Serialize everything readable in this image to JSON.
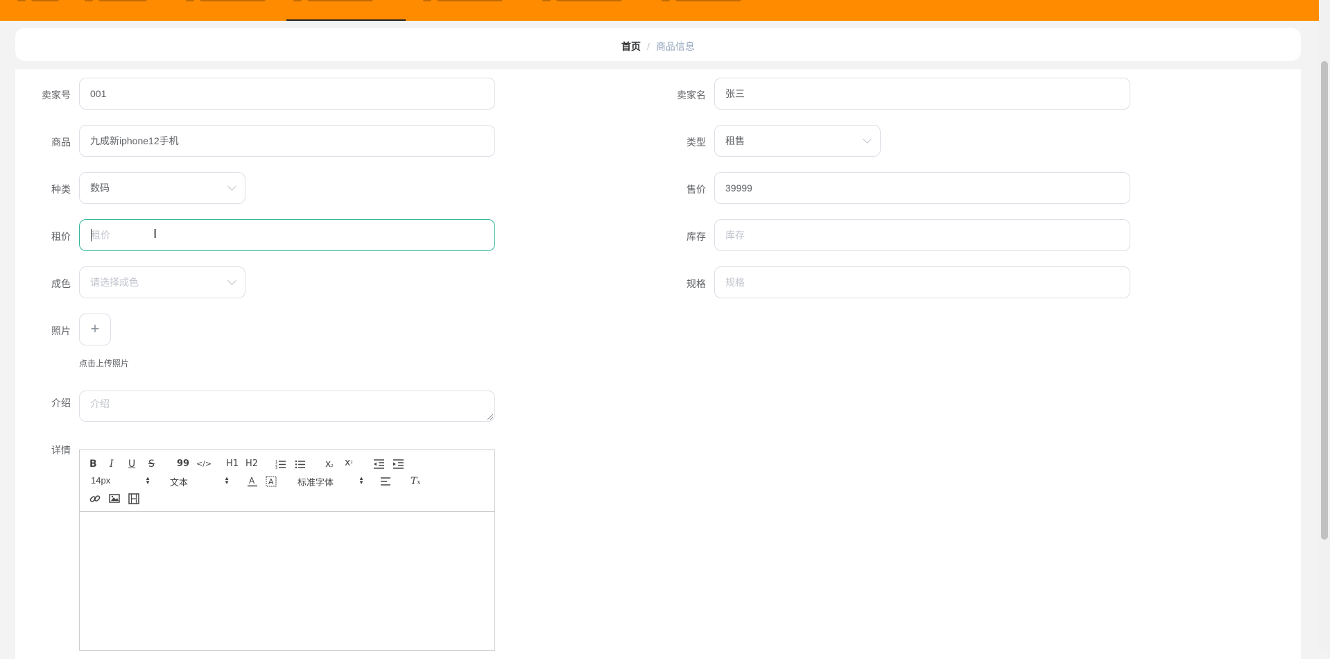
{
  "breadcrumb": {
    "home": "首页",
    "separator": "/",
    "current": "商品信息"
  },
  "form": {
    "seller_id": {
      "label": "卖家号",
      "value": "001"
    },
    "seller_name": {
      "label": "卖家名",
      "value": "张三"
    },
    "product": {
      "label": "商品",
      "value": "九成新iphone12手机"
    },
    "type": {
      "label": "类型",
      "value": "租售"
    },
    "category": {
      "label": "种类",
      "value": "数码"
    },
    "price": {
      "label": "售价",
      "value": "39999"
    },
    "rent_price": {
      "label": "租价",
      "placeholder": "租价"
    },
    "stock": {
      "label": "库存",
      "placeholder": "库存"
    },
    "condition": {
      "label": "成色",
      "placeholder": "请选择成色"
    },
    "spec": {
      "label": "规格",
      "placeholder": "规格"
    },
    "photo": {
      "label": "照片",
      "plus": "+",
      "hint": "点击上传照片"
    },
    "intro": {
      "label": "介绍",
      "placeholder": "介绍"
    },
    "details": {
      "label": "详情"
    }
  },
  "editor": {
    "bold": "B",
    "italic": "I",
    "underline": "U",
    "strike": "S",
    "quote": "99",
    "code": "</>",
    "h1": "H1",
    "h2": "H2",
    "subscript": "x2",
    "superscript": "x2",
    "clear_format": "Tx",
    "font_size": "14px",
    "header_select": "文本",
    "font_family": "标准字体"
  },
  "colors": {
    "topbar": "#ff8c00",
    "focus": "#2fb59c"
  }
}
